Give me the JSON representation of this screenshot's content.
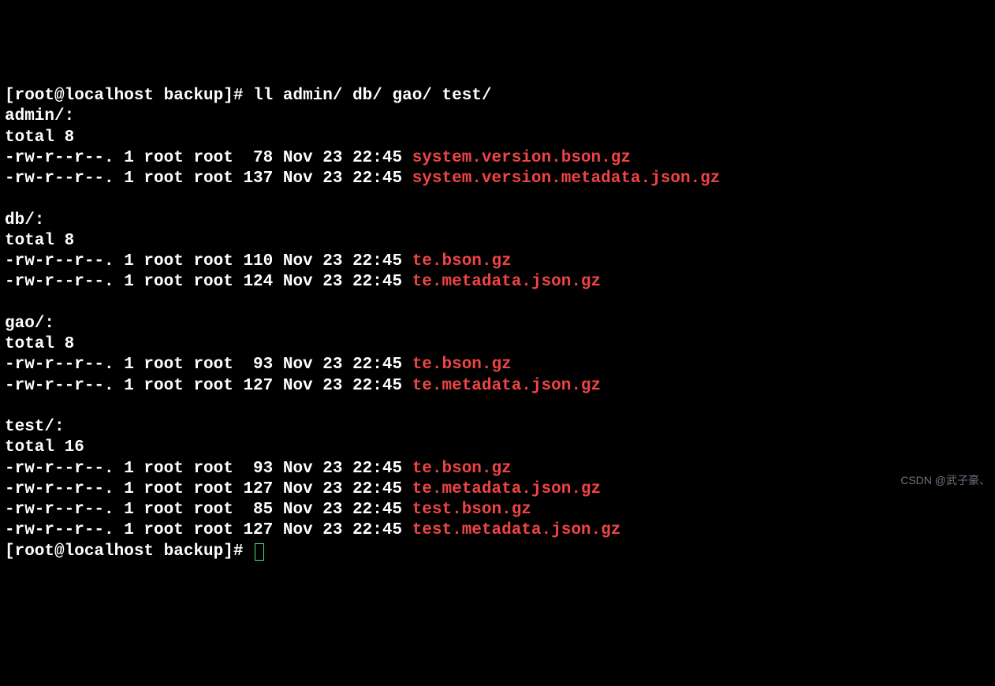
{
  "prompt1": "[root@localhost backup]# ",
  "command": "ll admin/ db/ gao/ test/",
  "dirs": [
    {
      "name": "admin/:",
      "total": "total 8",
      "files": [
        {
          "meta": "-rw-r--r--. 1 root root  78 Nov 23 22:45 ",
          "fname": "system.version.bson.gz"
        },
        {
          "meta": "-rw-r--r--. 1 root root 137 Nov 23 22:45 ",
          "fname": "system.version.metadata.json.gz"
        }
      ]
    },
    {
      "name": "db/:",
      "total": "total 8",
      "files": [
        {
          "meta": "-rw-r--r--. 1 root root 110 Nov 23 22:45 ",
          "fname": "te.bson.gz"
        },
        {
          "meta": "-rw-r--r--. 1 root root 124 Nov 23 22:45 ",
          "fname": "te.metadata.json.gz"
        }
      ]
    },
    {
      "name": "gao/:",
      "total": "total 8",
      "files": [
        {
          "meta": "-rw-r--r--. 1 root root  93 Nov 23 22:45 ",
          "fname": "te.bson.gz"
        },
        {
          "meta": "-rw-r--r--. 1 root root 127 Nov 23 22:45 ",
          "fname": "te.metadata.json.gz"
        }
      ]
    },
    {
      "name": "test/:",
      "total": "total 16",
      "files": [
        {
          "meta": "-rw-r--r--. 1 root root  93 Nov 23 22:45 ",
          "fname": "te.bson.gz"
        },
        {
          "meta": "-rw-r--r--. 1 root root 127 Nov 23 22:45 ",
          "fname": "te.metadata.json.gz"
        },
        {
          "meta": "-rw-r--r--. 1 root root  85 Nov 23 22:45 ",
          "fname": "test.bson.gz"
        },
        {
          "meta": "-rw-r--r--. 1 root root 127 Nov 23 22:45 ",
          "fname": "test.metadata.json.gz"
        }
      ]
    }
  ],
  "prompt2": "[root@localhost backup]# ",
  "watermark": "CSDN @武子豪、"
}
